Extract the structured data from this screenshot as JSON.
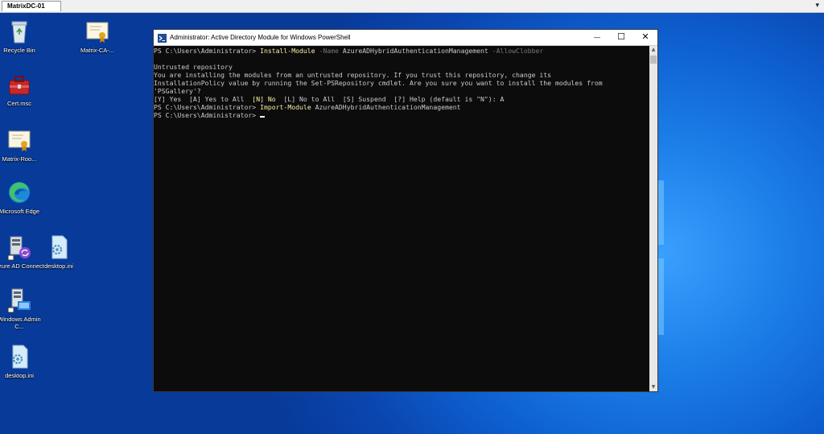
{
  "host": {
    "tab_label": "MatrixDC-01",
    "menu_glyph": "▾"
  },
  "desktop_icons": [
    {
      "label": "Recycle Bin",
      "icon": "recycle-bin-icon"
    },
    {
      "label": "Matrix-CA-...",
      "icon": "certificate-icon"
    },
    {
      "label": "Cert.msc",
      "icon": "toolbox-icon"
    },
    {
      "label": "Matrix-Roo...",
      "icon": "certificate-icon"
    },
    {
      "label": "Microsoft Edge",
      "icon": "edge-icon"
    },
    {
      "label": "Azure AD Connect",
      "icon": "azure-ad-connect-icon"
    },
    {
      "label": "desktop.ini",
      "icon": "settings-file-icon"
    },
    {
      "label": "Windows Admin C...",
      "icon": "windows-admin-center-icon"
    },
    {
      "label": "desktop.ini",
      "icon": "settings-file-icon"
    }
  ],
  "window": {
    "title": "Administrator: Active Directory Module for Windows PowerShell",
    "minimize": "—",
    "maximize": "☐",
    "close": "✕"
  },
  "console": {
    "prompt": "PS C:\\Users\\Administrator> ",
    "cmd1": "Install-Module",
    "cmd1_p1": " -Name",
    "cmd1_v1": " AzureADHybridAuthenticationManagement",
    "cmd1_p2": " -AllowClobber",
    "blank": "",
    "warn1": "Untrusted repository",
    "warn2": "You are installing the modules from an untrusted repository. If you trust this repository, change its",
    "warn3": "InstallationPolicy value by running the Set-PSRepository cmdlet. Are you sure you want to install the modules from",
    "warn4": "'PSGallery'?",
    "choice_a": "[Y] Yes  [A] Yes to All  ",
    "choice_n": "[N] No",
    "choice_b": "  [L] No to All  [S] Suspend  [?] Help (default is \"N\"): A",
    "cmd2": "Import-Module",
    "cmd2_v": " AzureADHybridAuthenticationManagement"
  },
  "colors": {
    "console_bg": "#0c0c0c",
    "console_text": "#cccccc",
    "cmdlet": "#f9f1a5",
    "parameter": "#767676"
  }
}
